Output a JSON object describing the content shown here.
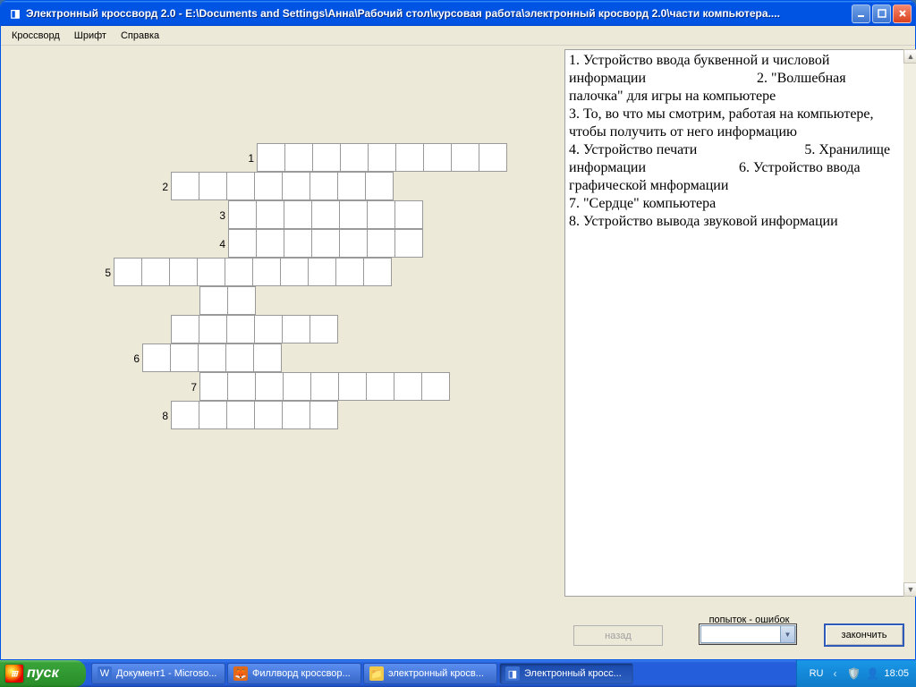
{
  "window": {
    "title": "Электронный кроссворд 2.0  -  E:\\Documents and Settings\\Анна\\Рабочий стол\\курсовая работа\\электронный кросворд 2.0\\части компьютера....",
    "menu": [
      "Кроссворд",
      "Шрифт",
      "Справка"
    ]
  },
  "crossword": {
    "words": [
      {
        "n": "1",
        "nrow": 0,
        "ncol": 5,
        "cells": [
          {
            "r": 0,
            "c": 6
          },
          {
            "r": 0,
            "c": 7
          },
          {
            "r": 0,
            "c": 8
          },
          {
            "r": 0,
            "c": 9
          },
          {
            "r": 0,
            "c": 10
          },
          {
            "r": 0,
            "c": 11
          },
          {
            "r": 0,
            "c": 12
          },
          {
            "r": 0,
            "c": 13
          },
          {
            "r": 0,
            "c": 14
          }
        ]
      },
      {
        "n": "2",
        "nrow": 1,
        "ncol": 2,
        "cells": [
          {
            "r": 1,
            "c": 3
          },
          {
            "r": 1,
            "c": 4
          },
          {
            "r": 1,
            "c": 5
          },
          {
            "r": 1,
            "c": 6
          },
          {
            "r": 1,
            "c": 7
          },
          {
            "r": 1,
            "c": 8
          },
          {
            "r": 1,
            "c": 9
          },
          {
            "r": 1,
            "c": 10
          }
        ]
      },
      {
        "n": "3",
        "nrow": 2,
        "ncol": 4,
        "cells": [
          {
            "r": 2,
            "c": 5
          },
          {
            "r": 2,
            "c": 6
          },
          {
            "r": 2,
            "c": 7
          },
          {
            "r": 2,
            "c": 8
          },
          {
            "r": 2,
            "c": 9
          },
          {
            "r": 2,
            "c": 10
          },
          {
            "r": 2,
            "c": 11
          }
        ]
      },
      {
        "n": "4",
        "nrow": 3,
        "ncol": 4,
        "cells": [
          {
            "r": 3,
            "c": 5
          },
          {
            "r": 3,
            "c": 6
          },
          {
            "r": 3,
            "c": 7
          },
          {
            "r": 3,
            "c": 8
          },
          {
            "r": 3,
            "c": 9
          },
          {
            "r": 3,
            "c": 10
          },
          {
            "r": 3,
            "c": 11
          }
        ]
      },
      {
        "n": "5",
        "nrow": 4,
        "ncol": 0,
        "cells": [
          {
            "r": 4,
            "c": 1
          },
          {
            "r": 4,
            "c": 2
          },
          {
            "r": 4,
            "c": 3
          },
          {
            "r": 4,
            "c": 4
          },
          {
            "r": 4,
            "c": 5
          },
          {
            "r": 4,
            "c": 6
          },
          {
            "r": 4,
            "c": 7
          },
          {
            "r": 4,
            "c": 8
          },
          {
            "r": 4,
            "c": 9
          },
          {
            "r": 4,
            "c": 10
          }
        ]
      },
      {
        "cells": [
          {
            "r": 5,
            "c": 4
          },
          {
            "r": 5,
            "c": 5
          }
        ]
      },
      {
        "cells": [
          {
            "r": 6,
            "c": 3
          },
          {
            "r": 6,
            "c": 4
          },
          {
            "r": 6,
            "c": 5
          },
          {
            "r": 6,
            "c": 6
          },
          {
            "r": 6,
            "c": 7
          },
          {
            "r": 6,
            "c": 8
          }
        ]
      },
      {
        "n": "6",
        "nrow": 7,
        "ncol": 1,
        "cells": [
          {
            "r": 7,
            "c": 2
          },
          {
            "r": 7,
            "c": 3
          },
          {
            "r": 7,
            "c": 4
          },
          {
            "r": 7,
            "c": 5
          },
          {
            "r": 7,
            "c": 6
          }
        ]
      },
      {
        "n": "7",
        "nrow": 8,
        "ncol": 3,
        "cells": [
          {
            "r": 8,
            "c": 4
          },
          {
            "r": 8,
            "c": 5
          },
          {
            "r": 8,
            "c": 6
          },
          {
            "r": 8,
            "c": 7
          },
          {
            "r": 8,
            "c": 8
          },
          {
            "r": 8,
            "c": 9
          },
          {
            "r": 8,
            "c": 10
          },
          {
            "r": 8,
            "c": 11
          },
          {
            "r": 8,
            "c": 12
          }
        ]
      },
      {
        "n": "8",
        "nrow": 9,
        "ncol": 2,
        "cells": [
          {
            "r": 9,
            "c": 3
          },
          {
            "r": 9,
            "c": 4
          },
          {
            "r": 9,
            "c": 5
          },
          {
            "r": 9,
            "c": 6
          },
          {
            "r": 9,
            "c": 7
          },
          {
            "r": 9,
            "c": 8
          }
        ]
      }
    ],
    "cols": 15,
    "rows": 10
  },
  "clues_text": "1. Устройство ввода буквенной и числовой информации                               2. \"Волшебная палочка\" для игры на компьютере\n3. То, во что мы смотрим, работая на компьютере, чтобы получить от него информацию\n4. Устройство печати                              5. Хранилище информации                          6. Устройство ввода графической мнформации\n7. \"Сердце\" компьютера\n8. Устройство вывода звуковой информации",
  "buttons": {
    "back": "назад",
    "finish": "закончить",
    "attempts_label": "попыток - ошибок"
  },
  "taskbar": {
    "start": "пуск",
    "items": [
      {
        "icon": "word-icon",
        "glyph": "W",
        "label": "Документ1 - Microso...",
        "bg": "#3b6fd1"
      },
      {
        "icon": "firefox-icon",
        "glyph": "🦊",
        "label": "Филлворд кроссвор...",
        "bg": "#e06a1a"
      },
      {
        "icon": "folder-icon",
        "glyph": "📁",
        "label": "электронный кросв...",
        "bg": "#f0c94a"
      },
      {
        "icon": "app-icon",
        "glyph": "◨",
        "label": "Электронный кросс...",
        "bg": "#3b6fd1"
      }
    ],
    "tray": {
      "lang": "RU",
      "time": "18:05"
    }
  }
}
